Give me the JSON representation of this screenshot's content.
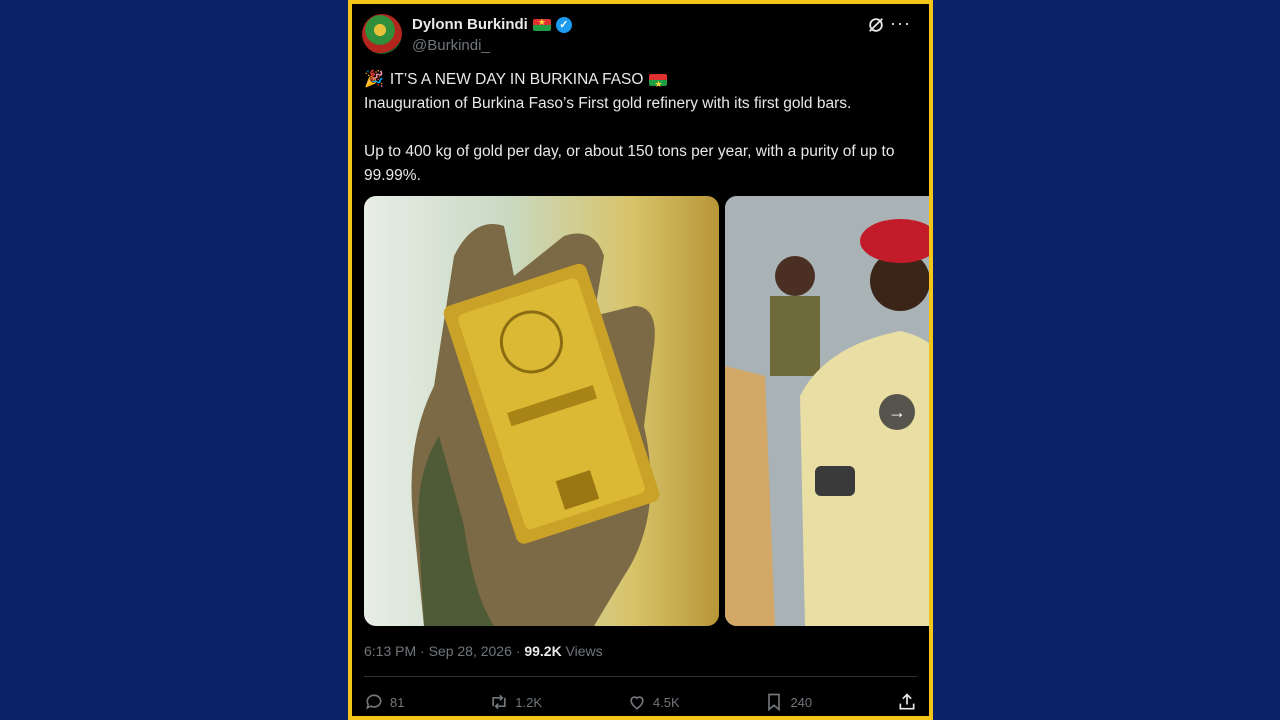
{
  "author": {
    "name": "Dylonn Burkindi",
    "handle": "@Burkindi_"
  },
  "tweet": {
    "headline": "IT’S A NEW DAY IN BURKINA FASO",
    "line2": "Inauguration of Burkina Faso’s First gold refinery with its first gold bars.",
    "line3": "Up to 400 kg of gold per day, or about 150 tons per year, with a purity of up to 99.99%."
  },
  "meta": {
    "time": "6:13 PM · Sep 28, 2026 · ",
    "views_count": "99.2K",
    "views_label": " Views"
  },
  "actions": {
    "replies": "81",
    "retweets": "1.2K",
    "likes": "4.5K",
    "bookmarks": "240"
  },
  "colors": {
    "background": "#0b2269",
    "card_border": "#f5c518",
    "card_bg": "#000000",
    "verified": "#1d9bf0"
  },
  "icons": [
    "avatar",
    "flag-icon",
    "verified-icon",
    "grok-icon",
    "more-icon",
    "party-popper-icon",
    "next-arrow-icon",
    "reply-icon",
    "retweet-icon",
    "like-icon",
    "bookmark-icon",
    "share-icon"
  ]
}
